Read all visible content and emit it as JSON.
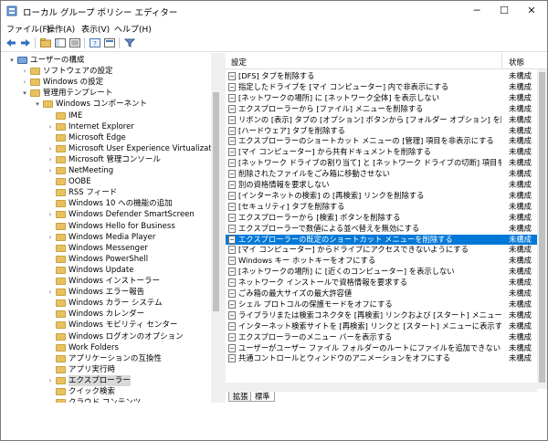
{
  "window": {
    "title": "ローカル グループ ポリシー エディター",
    "minimize": "─",
    "maximize": "☐",
    "close": "✕"
  },
  "menu": [
    "ファイル(F)",
    "操作(A)",
    "表示(V)",
    "ヘルプ(H)"
  ],
  "tree": [
    {
      "label": "ユーザーの構成",
      "level": 0,
      "exp": "▾",
      "icon": "computer-icon"
    },
    {
      "label": "ソフトウェアの設定",
      "level": 1,
      "exp": "›"
    },
    {
      "label": "Windows の設定",
      "level": 1,
      "exp": "›"
    },
    {
      "label": "管理用テンプレート",
      "level": 1,
      "exp": "▾"
    },
    {
      "label": "Windows コンポーネント",
      "level": 2,
      "exp": "▾"
    },
    {
      "label": "IME",
      "level": 3,
      "exp": ""
    },
    {
      "label": "Internet Explorer",
      "level": 3,
      "exp": "›"
    },
    {
      "label": "Microsoft Edge",
      "level": 3,
      "exp": ""
    },
    {
      "label": "Microsoft User Experience Virtualization",
      "level": 3,
      "exp": "›"
    },
    {
      "label": "Microsoft 管理コンソール",
      "level": 3,
      "exp": "›"
    },
    {
      "label": "NetMeeting",
      "level": 3,
      "exp": "›"
    },
    {
      "label": "OOBE",
      "level": 3,
      "exp": ""
    },
    {
      "label": "RSS フィード",
      "level": 3,
      "exp": ""
    },
    {
      "label": "Windows 10 への機能の追加",
      "level": 3,
      "exp": ""
    },
    {
      "label": "Windows Defender SmartScreen",
      "level": 3,
      "exp": "›"
    },
    {
      "label": "Windows Hello for Business",
      "level": 3,
      "exp": ""
    },
    {
      "label": "Windows Media Player",
      "level": 3,
      "exp": "›"
    },
    {
      "label": "Windows Messenger",
      "level": 3,
      "exp": ""
    },
    {
      "label": "Windows PowerShell",
      "level": 3,
      "exp": ""
    },
    {
      "label": "Windows Update",
      "level": 3,
      "exp": ""
    },
    {
      "label": "Windows インストーラー",
      "level": 3,
      "exp": ""
    },
    {
      "label": "Windows エラー報告",
      "level": 3,
      "exp": "›"
    },
    {
      "label": "Windows カラー システム",
      "level": 3,
      "exp": ""
    },
    {
      "label": "Windows カレンダー",
      "level": 3,
      "exp": ""
    },
    {
      "label": "Windows モビリティ センター",
      "level": 3,
      "exp": ""
    },
    {
      "label": "Windows ログオンのオプション",
      "level": 3,
      "exp": ""
    },
    {
      "label": "Work Folders",
      "level": 3,
      "exp": ""
    },
    {
      "label": "アプリケーションの互換性",
      "level": 3,
      "exp": ""
    },
    {
      "label": "アプリ実行時",
      "level": 3,
      "exp": ""
    },
    {
      "label": "エクスプローラー",
      "level": 3,
      "exp": "›",
      "selected": true
    },
    {
      "label": "クイック検索",
      "level": 3,
      "exp": ""
    },
    {
      "label": "クラウド コンテンツ",
      "level": 3,
      "exp": ""
    }
  ],
  "list": {
    "header_setting": "設定",
    "header_state": "状態",
    "rows": [
      {
        "text": "[DFS] タブを削除する",
        "state": "未構成"
      },
      {
        "text": "指定したドライブを [マイ コンピューター] 内で非表示にする",
        "state": "未構成"
      },
      {
        "text": "[ネットワークの場所] に [ネットワーク全体] を表示しない",
        "state": "未構成"
      },
      {
        "text": "エクスプローラーから [ファイル] メニューを削除する",
        "state": "未構成"
      },
      {
        "text": "リボンの [表示] タブの [オプション] ボタンから [フォルダー オプション] を開くことを許可しない",
        "state": "未構成"
      },
      {
        "text": "[ハードウェア] タブを削除する",
        "state": "未構成"
      },
      {
        "text": "エクスプローラーのショートカット メニューの [管理] 項目を非表示にする",
        "state": "未構成"
      },
      {
        "text": "[マイ コンピューター] から共有ドキュメントを削除する",
        "state": "未構成"
      },
      {
        "text": "[ネットワーク ドライブの割り当て] と [ネットワーク ドライブの切断] 項目を削除する",
        "state": "未構成"
      },
      {
        "text": "削除されたファイルをごみ箱に移動させない",
        "state": "未構成"
      },
      {
        "text": "別の資格情報を要求しない",
        "state": "未構成"
      },
      {
        "text": "[インターネットの検索] の [再検索] リンクを削除する",
        "state": "未構成"
      },
      {
        "text": "[セキュリティ] タブを削除する",
        "state": "未構成"
      },
      {
        "text": "エクスプローラーから [検索] ボタンを削除する",
        "state": "未構成"
      },
      {
        "text": "エクスプローラーで数値による並べ替えを無効にする",
        "state": "未構成"
      },
      {
        "text": "エクスプローラーの既定のショートカット メニューを削除する",
        "state": "未構成",
        "selected": true
      },
      {
        "text": "[マイ コンピューター] からドライブにアクセスできないようにする",
        "state": "未構成"
      },
      {
        "text": "Windows キー ホットキーをオフにする",
        "state": "未構成"
      },
      {
        "text": "[ネットワークの場所] に [近くのコンピューター] を表示しない",
        "state": "未構成"
      },
      {
        "text": "ネットワーク インストールで資格情報を要求する",
        "state": "未構成"
      },
      {
        "text": "ごみ箱の最大サイズの最大許容値",
        "state": "未構成"
      },
      {
        "text": "シェル プロトコルの保護モードをオフにする",
        "state": "未構成"
      },
      {
        "text": "ライブラリまたは検索コネクタを [再検索] リンクおよび [スタート] メニューに表示する",
        "state": "未構成"
      },
      {
        "text": "インターネット検索サイトを [再検索] リンクと [スタート] メニューに表示する",
        "state": "未構成"
      },
      {
        "text": "エクスプローラーのメニュー バーを表示する",
        "state": "未構成"
      },
      {
        "text": "ユーザーがユーザー ファイル フォルダーのルートにファイルを追加できないようにする",
        "state": "未構成"
      },
      {
        "text": "共通コントロールとウィンドウのアニメーションをオフにする",
        "state": "未構成"
      }
    ]
  },
  "tabs": [
    "拡張",
    "標準"
  ]
}
